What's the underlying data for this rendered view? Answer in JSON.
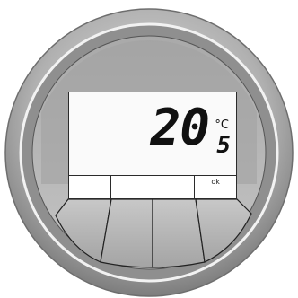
{
  "display": {
    "temperature_whole": "20",
    "temperature_decimal": "5",
    "unit": "°C"
  },
  "softkeys": [
    {
      "label": ""
    },
    {
      "label": ""
    },
    {
      "label": ""
    },
    {
      "label": "ok"
    }
  ],
  "colors": {
    "bezel_outer": "#9a9a9a",
    "bezel_highlight": "#d8d8d8",
    "face": "#b4b4b4",
    "lcd_background": "#fafafa",
    "segment": "#111111"
  }
}
